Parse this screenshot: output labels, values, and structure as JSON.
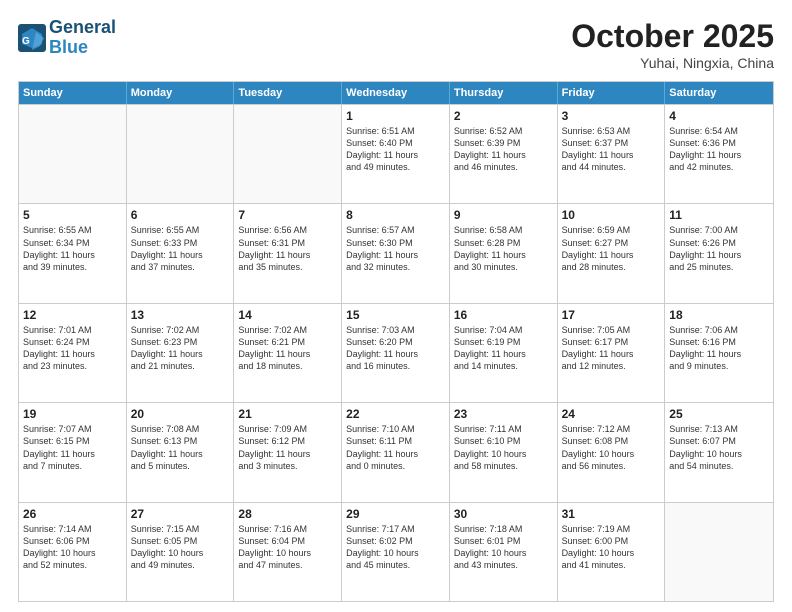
{
  "header": {
    "logo_line1": "General",
    "logo_line2": "Blue",
    "month": "October 2025",
    "location": "Yuhai, Ningxia, China"
  },
  "weekdays": [
    "Sunday",
    "Monday",
    "Tuesday",
    "Wednesday",
    "Thursday",
    "Friday",
    "Saturday"
  ],
  "rows": [
    [
      {
        "day": "",
        "info": ""
      },
      {
        "day": "",
        "info": ""
      },
      {
        "day": "",
        "info": ""
      },
      {
        "day": "1",
        "info": "Sunrise: 6:51 AM\nSunset: 6:40 PM\nDaylight: 11 hours\nand 49 minutes."
      },
      {
        "day": "2",
        "info": "Sunrise: 6:52 AM\nSunset: 6:39 PM\nDaylight: 11 hours\nand 46 minutes."
      },
      {
        "day": "3",
        "info": "Sunrise: 6:53 AM\nSunset: 6:37 PM\nDaylight: 11 hours\nand 44 minutes."
      },
      {
        "day": "4",
        "info": "Sunrise: 6:54 AM\nSunset: 6:36 PM\nDaylight: 11 hours\nand 42 minutes."
      }
    ],
    [
      {
        "day": "5",
        "info": "Sunrise: 6:55 AM\nSunset: 6:34 PM\nDaylight: 11 hours\nand 39 minutes."
      },
      {
        "day": "6",
        "info": "Sunrise: 6:55 AM\nSunset: 6:33 PM\nDaylight: 11 hours\nand 37 minutes."
      },
      {
        "day": "7",
        "info": "Sunrise: 6:56 AM\nSunset: 6:31 PM\nDaylight: 11 hours\nand 35 minutes."
      },
      {
        "day": "8",
        "info": "Sunrise: 6:57 AM\nSunset: 6:30 PM\nDaylight: 11 hours\nand 32 minutes."
      },
      {
        "day": "9",
        "info": "Sunrise: 6:58 AM\nSunset: 6:28 PM\nDaylight: 11 hours\nand 30 minutes."
      },
      {
        "day": "10",
        "info": "Sunrise: 6:59 AM\nSunset: 6:27 PM\nDaylight: 11 hours\nand 28 minutes."
      },
      {
        "day": "11",
        "info": "Sunrise: 7:00 AM\nSunset: 6:26 PM\nDaylight: 11 hours\nand 25 minutes."
      }
    ],
    [
      {
        "day": "12",
        "info": "Sunrise: 7:01 AM\nSunset: 6:24 PM\nDaylight: 11 hours\nand 23 minutes."
      },
      {
        "day": "13",
        "info": "Sunrise: 7:02 AM\nSunset: 6:23 PM\nDaylight: 11 hours\nand 21 minutes."
      },
      {
        "day": "14",
        "info": "Sunrise: 7:02 AM\nSunset: 6:21 PM\nDaylight: 11 hours\nand 18 minutes."
      },
      {
        "day": "15",
        "info": "Sunrise: 7:03 AM\nSunset: 6:20 PM\nDaylight: 11 hours\nand 16 minutes."
      },
      {
        "day": "16",
        "info": "Sunrise: 7:04 AM\nSunset: 6:19 PM\nDaylight: 11 hours\nand 14 minutes."
      },
      {
        "day": "17",
        "info": "Sunrise: 7:05 AM\nSunset: 6:17 PM\nDaylight: 11 hours\nand 12 minutes."
      },
      {
        "day": "18",
        "info": "Sunrise: 7:06 AM\nSunset: 6:16 PM\nDaylight: 11 hours\nand 9 minutes."
      }
    ],
    [
      {
        "day": "19",
        "info": "Sunrise: 7:07 AM\nSunset: 6:15 PM\nDaylight: 11 hours\nand 7 minutes."
      },
      {
        "day": "20",
        "info": "Sunrise: 7:08 AM\nSunset: 6:13 PM\nDaylight: 11 hours\nand 5 minutes."
      },
      {
        "day": "21",
        "info": "Sunrise: 7:09 AM\nSunset: 6:12 PM\nDaylight: 11 hours\nand 3 minutes."
      },
      {
        "day": "22",
        "info": "Sunrise: 7:10 AM\nSunset: 6:11 PM\nDaylight: 11 hours\nand 0 minutes."
      },
      {
        "day": "23",
        "info": "Sunrise: 7:11 AM\nSunset: 6:10 PM\nDaylight: 10 hours\nand 58 minutes."
      },
      {
        "day": "24",
        "info": "Sunrise: 7:12 AM\nSunset: 6:08 PM\nDaylight: 10 hours\nand 56 minutes."
      },
      {
        "day": "25",
        "info": "Sunrise: 7:13 AM\nSunset: 6:07 PM\nDaylight: 10 hours\nand 54 minutes."
      }
    ],
    [
      {
        "day": "26",
        "info": "Sunrise: 7:14 AM\nSunset: 6:06 PM\nDaylight: 10 hours\nand 52 minutes."
      },
      {
        "day": "27",
        "info": "Sunrise: 7:15 AM\nSunset: 6:05 PM\nDaylight: 10 hours\nand 49 minutes."
      },
      {
        "day": "28",
        "info": "Sunrise: 7:16 AM\nSunset: 6:04 PM\nDaylight: 10 hours\nand 47 minutes."
      },
      {
        "day": "29",
        "info": "Sunrise: 7:17 AM\nSunset: 6:02 PM\nDaylight: 10 hours\nand 45 minutes."
      },
      {
        "day": "30",
        "info": "Sunrise: 7:18 AM\nSunset: 6:01 PM\nDaylight: 10 hours\nand 43 minutes."
      },
      {
        "day": "31",
        "info": "Sunrise: 7:19 AM\nSunset: 6:00 PM\nDaylight: 10 hours\nand 41 minutes."
      },
      {
        "day": "",
        "info": ""
      }
    ]
  ]
}
